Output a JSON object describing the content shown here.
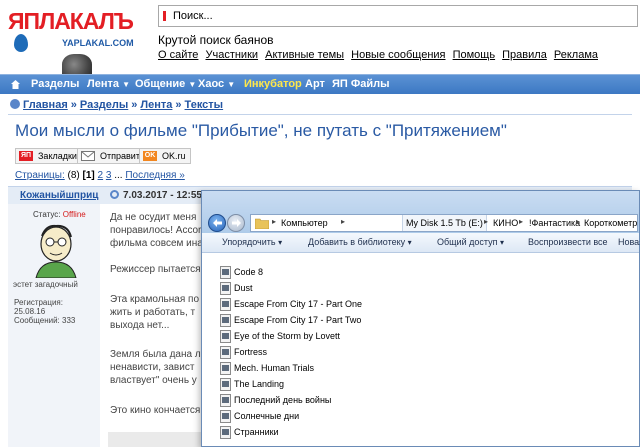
{
  "site": {
    "logo_text": "ЯПЛАКАЛЪ",
    "logo_sub": "YAPLAKAL.COM",
    "search_placeholder": "Поиск...",
    "tagline": "Крутой поиск баянов",
    "top_links": [
      "О сайте",
      "Участники",
      "Активные темы",
      "Новые сообщения",
      "Помощь",
      "Правила",
      "Реклама"
    ]
  },
  "nav": {
    "items": [
      {
        "label": "Разделы",
        "caret": false
      },
      {
        "label": "Лента",
        "caret": true
      },
      {
        "label": "Общение",
        "caret": true
      },
      {
        "label": "Хаос",
        "caret": true
      },
      {
        "label": "Инкубатор",
        "caret": false,
        "highlight": true
      },
      {
        "label": "Арт",
        "caret": false
      },
      {
        "label": "ЯП Файлы",
        "caret": false
      }
    ],
    "highlight_color": "#ffe84a"
  },
  "breadcrumb": [
    "Главная",
    "Разделы",
    "Лента",
    "Тексты"
  ],
  "page_title": "Мои мысли о фильме \"Прибытие\", не путать с \"Притяжением\"",
  "share": {
    "bookmarks": "Закладки",
    "send": "Отправить",
    "ok": "OK.ru",
    "bookmarks_icon_text": "ЯП",
    "ok_icon_text": "OK"
  },
  "pagination": {
    "label": "Страницы:",
    "total": "(8)",
    "current": "[1]",
    "pages": [
      "2",
      "3"
    ],
    "ellipsis": "...",
    "last": "Последняя »"
  },
  "post": {
    "author": "Кожаныйшприц",
    "date": "7.03.2017 - 12:55",
    "status_label": "Статус:",
    "status_value": "Offline",
    "user_title": "эстет загадочный",
    "registered_label": "Регистрация:",
    "registered_value": "25.08.16",
    "messages_label": "Сообщений:",
    "messages_value": "333",
    "lines": [
      "Да не осудит меня",
      "понравилось! Accor",
      "фильма совсем ина",
      "Режиссер пытается",
      "Эта крамольная по",
      "жить и работать, т",
      "выхода нет...",
      "Земля была дана л",
      "ненависти, завист",
      "властвует\" очень у",
      "Это кино кончается"
    ]
  },
  "explorer": {
    "path": [
      "Компьютер",
      "My Disk 1.5 Tb (E:)",
      "КИНО",
      "!Фантастика",
      "Короткометражки"
    ],
    "toolbar": [
      "Упорядочить",
      "Добавить в библиотеку",
      "Общий доступ",
      "Воспроизвести все",
      "Новая"
    ],
    "files": [
      "Code 8",
      "Dust",
      "Escape From City 17 - Part One",
      "Escape From City 17 - Part Two",
      "Eye of the Storm by Lovett",
      "Fortress",
      "Mech. Human Trials",
      "The Landing",
      "Последний день войны",
      "Солнечные дни",
      "Странники"
    ]
  },
  "colors": {
    "nav_bg": "#3c78c3",
    "link": "#2254a2",
    "title": "#2a5aa4",
    "offline": "#d51a1a",
    "logo_red": "#e31e24"
  }
}
